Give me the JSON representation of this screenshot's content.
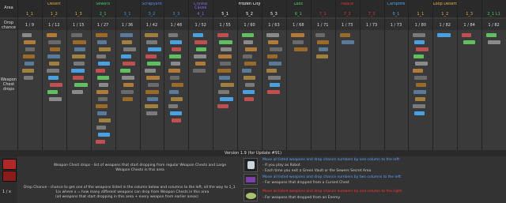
{
  "header": {
    "area_label": "Area",
    "drop_label": "Drop chance",
    "weapon_label": "Weapon Chest drops",
    "version_title": "Version 1.9 (for Update #91)"
  },
  "areas": [
    {
      "name": "Desert",
      "color": "#e8b040",
      "cols": [
        "1_1",
        "1_2",
        "1_3"
      ]
    },
    {
      "name": "Sewers",
      "color": "#3fcf5f",
      "cols": [
        "2_1"
      ]
    },
    {
      "name": "Scrapyard",
      "color": "#4a8cf0",
      "cols": [
        "3_1",
        "3_2",
        "3_3"
      ]
    },
    {
      "name": "Crystal Caves",
      "color": "#8a6af0",
      "cols": [
        "4_1"
      ]
    },
    {
      "name": "Frozen City",
      "color": "#ffffff",
      "cols": [
        "5_1",
        "5_2",
        "5_3"
      ]
    },
    {
      "name": "Labs",
      "color": "#3fcf5f",
      "cols": [
        "6_1"
      ]
    },
    {
      "name": "Palace",
      "color": "#e03030",
      "cols": [
        "7_1",
        "7_2",
        "7_3"
      ]
    },
    {
      "name": "Campfire",
      "color": "#4aa8f0",
      "cols": [
        "0_1"
      ]
    },
    {
      "name": "Loop Desert",
      "color": "#e8b040",
      "cols": [
        "1_1",
        "1_2",
        "1_3"
      ]
    },
    {
      "name": "",
      "color": "#3fcf5f",
      "cols": [
        "2_1 L1"
      ]
    }
  ],
  "drop_chances": [
    "1 / 9",
    "1 / 12",
    "1 / 15",
    "1 / 27",
    "1 / 36",
    "1 / 42",
    "1 / 48",
    "1 / 52",
    "1 / 55",
    "1 / 60",
    "1 / 63",
    "1 / 68",
    "1 / 71",
    "1 / 73",
    "1 / 73",
    "1 / 73",
    "1 / 80",
    "1 / 82",
    "1 / 84",
    "1 / 82"
  ],
  "legend": {
    "chest_text": "Weapon Chest drops - list of weapons that start dropping from regular Weapon Chests and Large Weapon Chests in this area",
    "drop_text_1": "Drop Chance - chance to get one of the weapons listed in the column below and columns to the left, all the way to 1_1",
    "drop_text_2": "1/x where x = how many different weapons can drop from Weapon Chests in this area",
    "drop_text_3": "(all weapons that start dropping in this area + every weapon from earlier areas)",
    "drop_ratio": "1 / x",
    "robot_line1": "Move all listed weapons and drop chance numbers by one column to the left:",
    "robot_line2": "- If you play as Robot",
    "robot_line3": "- Each time you exit a Green Vault or the Sewers Secret Area",
    "cursed_line1": "Move all listed weapons and drop chance numbers by two columns to the left:",
    "cursed_line2": "- For weapons that dropped from a Cursed Chest",
    "enemy_line1": "Move all listed weapons and drop chance numbers by one column to the right:",
    "enemy_line2": "- For weapons that dropped from an Enemy"
  },
  "colors": {
    "bg": "#3a3a3a",
    "header_bg": "#2a2a2a",
    "legend_bg": "#333333",
    "robot_blue": "#5aa0ff",
    "cursed_blue": "#5aa0ff",
    "enemy_red": "#ff3030"
  }
}
